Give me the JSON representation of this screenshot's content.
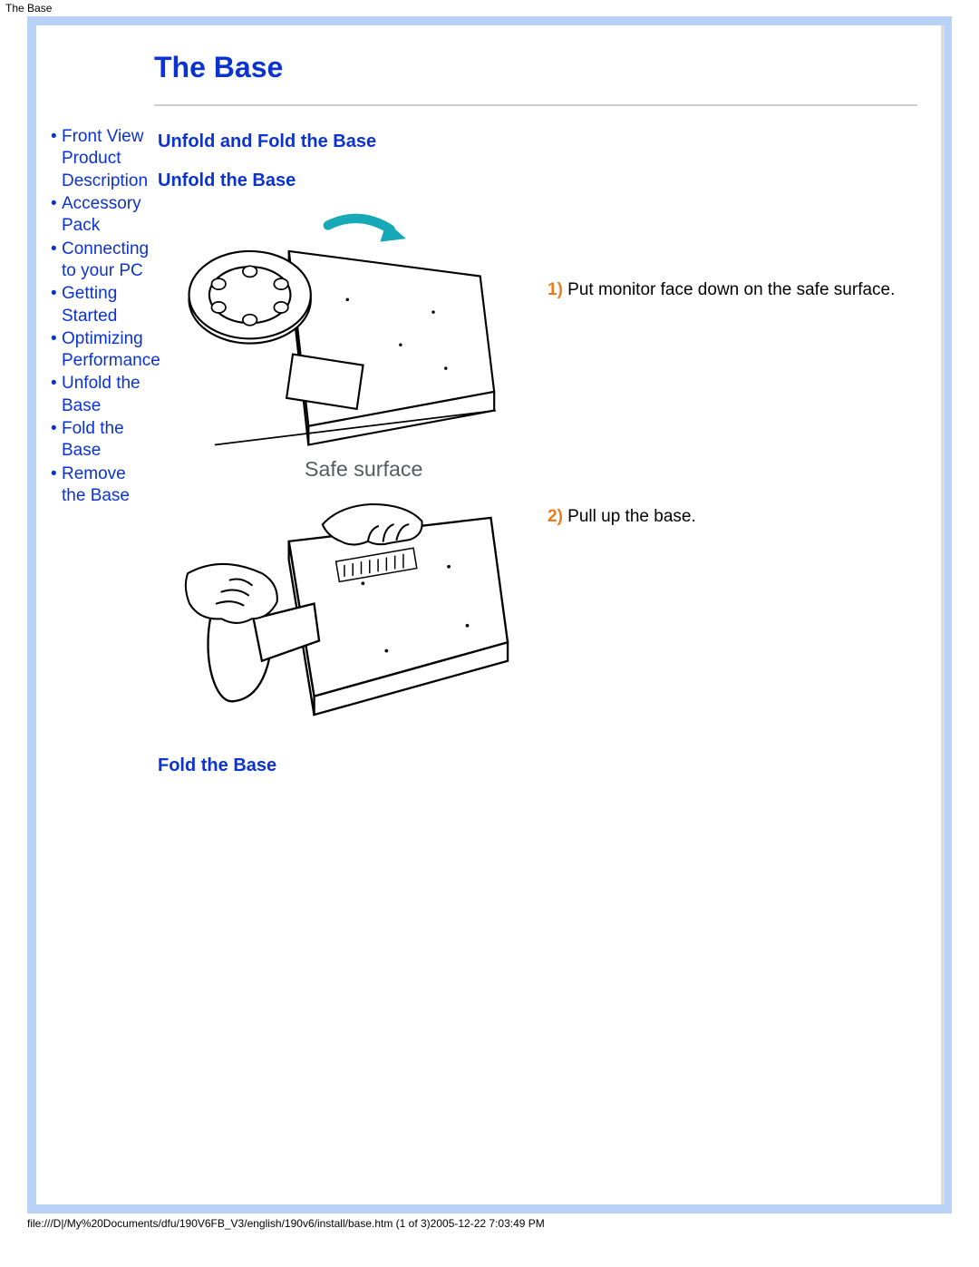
{
  "header": {
    "title": "The Base"
  },
  "page": {
    "title": "The Base"
  },
  "sidebar": {
    "items": [
      {
        "label": "Front View Product Description"
      },
      {
        "label": "Accessory Pack"
      },
      {
        "label": "Connecting to your PC"
      },
      {
        "label": "Getting Started"
      },
      {
        "label": "Optimizing Performance"
      },
      {
        "label": "Unfold the Base"
      },
      {
        "label": "Fold the Base"
      },
      {
        "label": "Remove the Base"
      }
    ]
  },
  "main": {
    "section_title": "Unfold and Fold the Base",
    "unfold_title": "Unfold the Base",
    "fold_title": "Fold the Base",
    "steps": [
      {
        "num": "1)",
        "text": " Put monitor face down on the safe surface."
      },
      {
        "num": "2)",
        "text": " Pull up the base."
      }
    ],
    "fig1_caption": "Safe surface"
  },
  "footer": {
    "path": "file:///D|/My%20Documents/dfu/190V6FB_V3/english/190v6/install/base.htm (1 of 3)2005-12-22 7:03:49 PM"
  }
}
